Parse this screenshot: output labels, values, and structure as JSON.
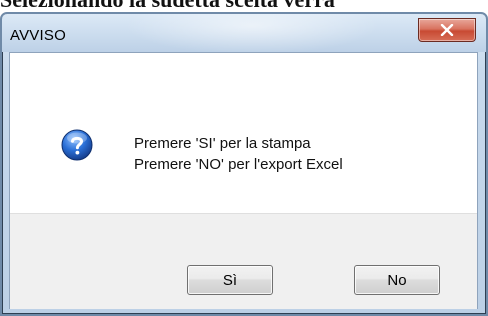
{
  "background": {
    "partial_text": "Selezionando la sudetta scelta verrà"
  },
  "dialog": {
    "title": "AVVISO",
    "icon": "question-icon",
    "message_lines": [
      "Premere 'SI' per la stampa",
      "Premere 'NO' per l'export Excel"
    ],
    "buttons": {
      "yes_label": "Sì",
      "no_label": "No"
    }
  },
  "colors": {
    "titlebar": "#c7d9ec",
    "close_button": "#c84a33",
    "icon_blue": "#1f63c6",
    "footer": "#f0f0f0"
  }
}
